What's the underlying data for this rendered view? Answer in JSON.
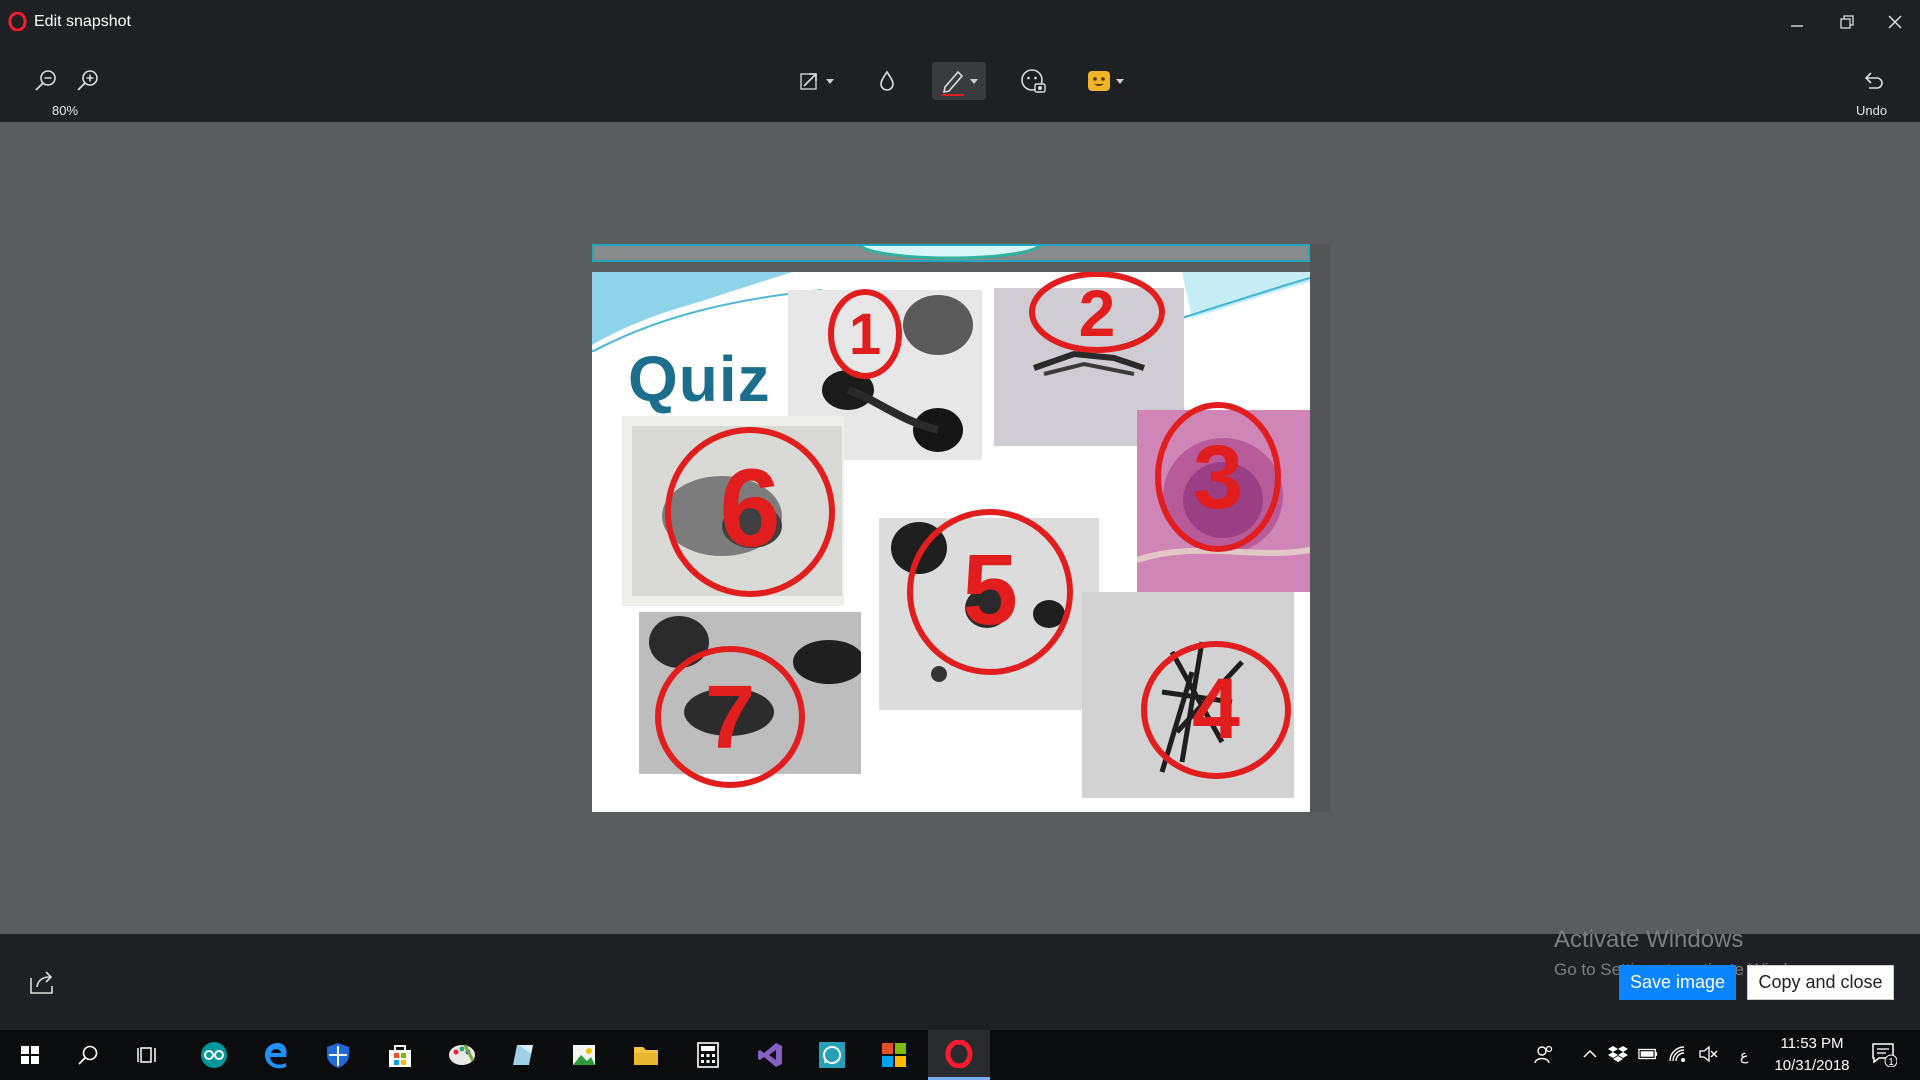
{
  "window": {
    "title": "Edit snapshot"
  },
  "toolbar": {
    "zoom_level": "80%",
    "undo_label": "Undo",
    "tools": [
      "arrow-tool",
      "blur-tool",
      "pen-tool",
      "selfie-tool",
      "emoji-tool"
    ],
    "pen_color": "#e11d1d"
  },
  "slide": {
    "title": "Quiz",
    "annotations": [
      "1",
      "2",
      "3",
      "4",
      "5",
      "6",
      "7"
    ]
  },
  "bottom": {
    "activate_title": "Activate Windows",
    "activate_sub": "Go to Settings to activate Windows.",
    "save_label": "Save image",
    "copy_label": "Copy and close"
  },
  "taskbar": {
    "apps": [
      "start",
      "search",
      "task-view",
      "arduino",
      "edge",
      "defender",
      "store",
      "paint",
      "notes",
      "photos",
      "file-explorer",
      "calculator",
      "visual-studio",
      "whatsapp",
      "office",
      "opera"
    ],
    "language": "ع",
    "time": "11:53 PM",
    "date": "10/31/2018",
    "notifications": "1"
  },
  "colors": {
    "accent": "#0a84ff",
    "title_teal": "#1b6f8c",
    "annotation_red": "#e11d1d",
    "chrome": "#1f2023"
  }
}
